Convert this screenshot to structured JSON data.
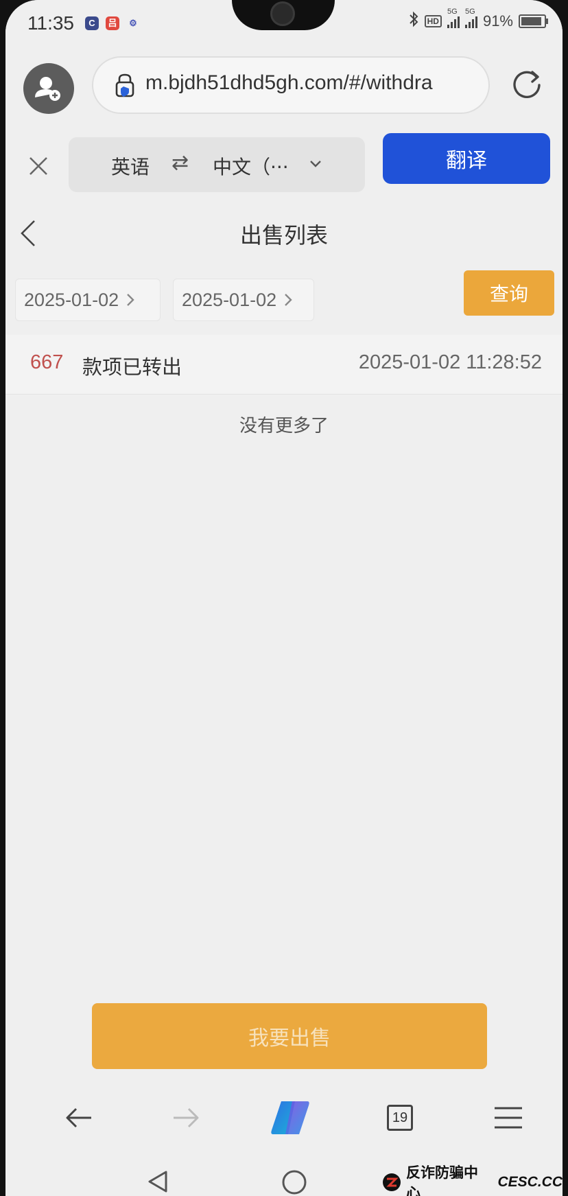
{
  "status_bar": {
    "time": "11:35",
    "app_icons": [
      "C",
      "吕",
      "⚙"
    ],
    "hd_label": "HD",
    "net1": "5G",
    "net2": "5G",
    "battery": "91%"
  },
  "browser": {
    "url": "m.bjdh51dhd5gh.com/#/withdra",
    "icons": {
      "profile": "profile-add-icon",
      "secure": "secure-lock-icon",
      "reload": "reload-icon"
    }
  },
  "translate": {
    "from": "英语",
    "swap": "⇄",
    "to": "中文（···",
    "button": "翻译"
  },
  "page": {
    "title": "出售列表"
  },
  "filter": {
    "start_date": "2025-01-02",
    "end_date": "2025-01-02",
    "query_label": "查询"
  },
  "records": [
    {
      "amount": "667",
      "status": "款项已转出",
      "time": "2025-01-02 11:28:52"
    }
  ],
  "list_footer": "没有更多了",
  "action": {
    "sell_label": "我要出售"
  },
  "bottom_nav": {
    "tab_count": "19"
  },
  "watermark": {
    "text": "反诈防骗中心",
    "site": "CESC.CC"
  },
  "colors": {
    "accent_orange": "#eba73b",
    "translate_blue": "#2052d8",
    "amount_red": "#c0504d"
  }
}
